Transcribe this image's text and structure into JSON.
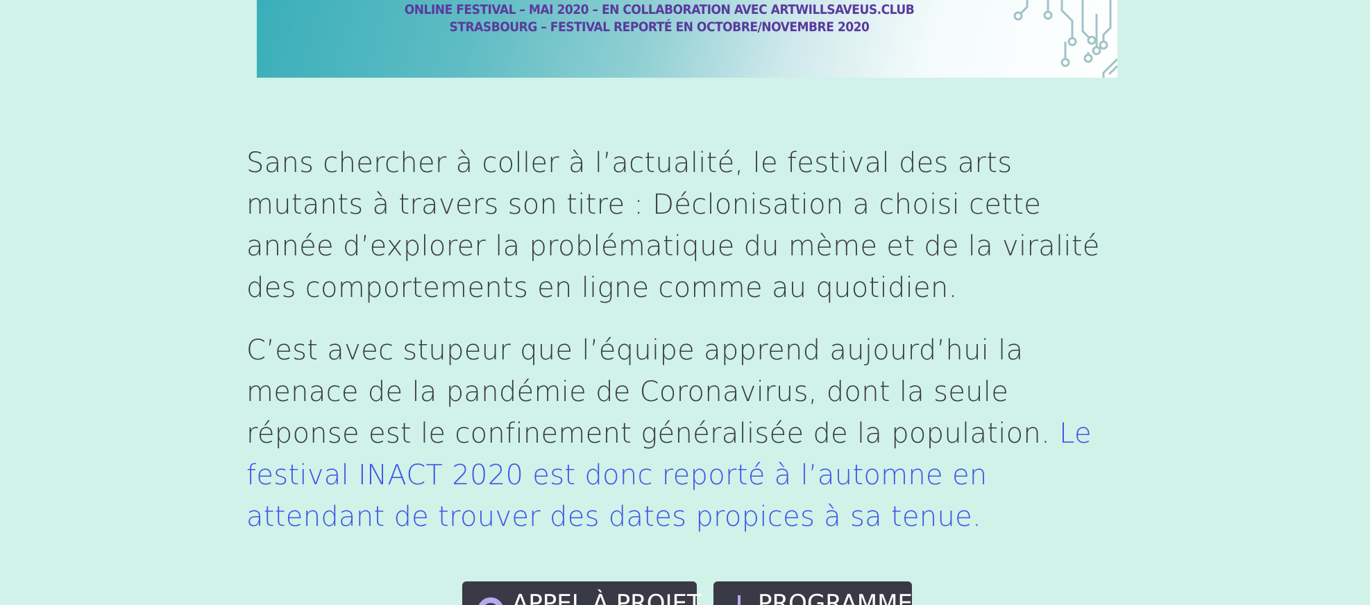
{
  "banner": {
    "line1": "ONLINE FESTIVAL – MAI 2020 – EN COLLABORATION AVEC ARTWILLSAVEUS.CLUB",
    "line2": "STRASBOURG – FESTIVAL REPORTÉ EN OCTOBRE/NOVEMBRE 2020"
  },
  "content": {
    "paragraph1": "Sans chercher à coller à l’actualité, le festival des arts mutants à travers son titre : Déclonisation a choisi cette année d’explorer la problématique du mème et de la viralité des comportements en ligne comme au quotidien.",
    "paragraph2_text": "C’est avec stupeur que l’équipe apprend aujourd’hui la menace de la pandémie de Coronavirus, dont la seule réponse est le confinement généralisée de la population. ",
    "paragraph2_link": "Le festival INACT 2020 est donc reporté à l’automne en attendant de trouver des dates propices à sa tenue."
  },
  "buttons": {
    "call_for_projects": "APPEL À PROJET",
    "program": "PROGRAMME"
  },
  "colors": {
    "background": "#d0f2e9",
    "text": "#3a3a44",
    "link": "#3f55e8",
    "button": "#3a3946",
    "button_icon": "#b7aaf0",
    "banner_text": "#5a3a9e"
  }
}
